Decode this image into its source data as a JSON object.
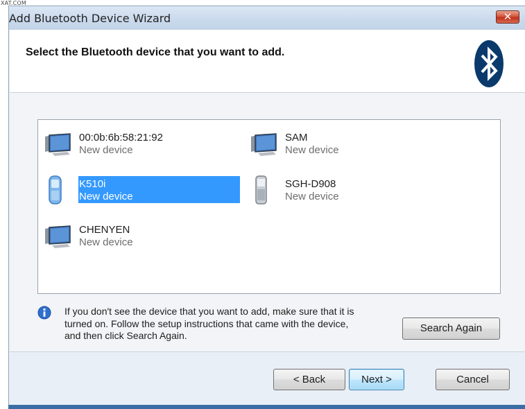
{
  "watermark": "XAT.COM",
  "window": {
    "title": "Add Bluetooth Device Wizard",
    "close_label": "✕"
  },
  "header": {
    "title": "Select the Bluetooth device that you want to add."
  },
  "devices": [
    {
      "name": "00:0b:6b:58:21:92",
      "status": "New device",
      "icon": "computer-icon",
      "selected": false
    },
    {
      "name": "SAM",
      "status": "New device",
      "icon": "computer-icon",
      "selected": false
    },
    {
      "name": "K510i",
      "status": "New device",
      "icon": "mobile-phone-icon",
      "selected": true
    },
    {
      "name": "SGH-D908",
      "status": "New device",
      "icon": "mobile-phone-icon",
      "selected": false
    },
    {
      "name": "CHENYEN",
      "status": "New device",
      "icon": "computer-icon",
      "selected": false
    }
  ],
  "info": {
    "line1": "If you don't see the device that you want to add, make sure that it is",
    "line2": "turned on. Follow the setup instructions that came with the device,",
    "line3": "and then click Search Again."
  },
  "buttons": {
    "search_again": "Search Again",
    "back": "< Back",
    "next": "Next >",
    "cancel": "Cancel"
  },
  "colors": {
    "selection": "#3399ff",
    "bluetooth_logo": "#0a3a6b",
    "close_button": "#c1311c"
  }
}
